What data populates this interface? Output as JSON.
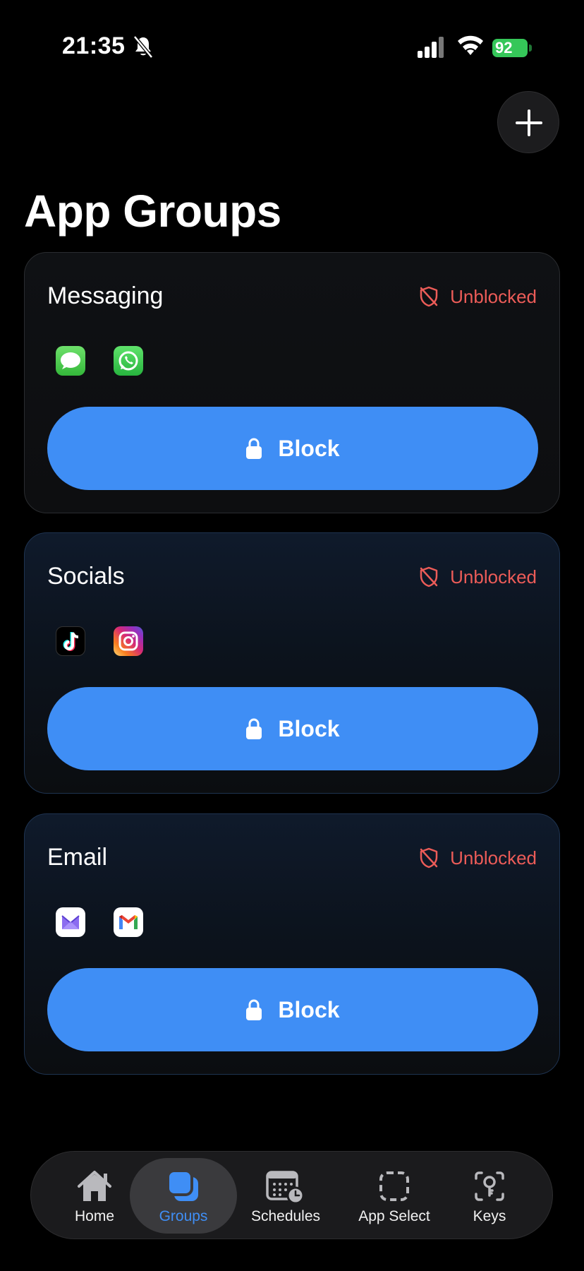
{
  "status_bar": {
    "time": "21:35",
    "battery": "92",
    "icons": [
      "bell-slash-icon",
      "signal-icon",
      "wifi-icon",
      "battery-icon"
    ]
  },
  "header": {
    "title": "App Groups",
    "add_icon": "plus-icon"
  },
  "groups": [
    {
      "name": "Messaging",
      "status": "Unblocked",
      "apps": [
        "messages-app-icon",
        "whatsapp-app-icon"
      ],
      "button_label": "Block"
    },
    {
      "name": "Socials",
      "status": "Unblocked",
      "apps": [
        "tiktok-app-icon",
        "instagram-app-icon"
      ],
      "button_label": "Block"
    },
    {
      "name": "Email",
      "status": "Unblocked",
      "apps": [
        "proton-mail-app-icon",
        "gmail-app-icon"
      ],
      "button_label": "Block"
    }
  ],
  "tab_bar": {
    "items": [
      {
        "label": "Home",
        "icon": "house-icon",
        "active": false
      },
      {
        "label": "Groups",
        "icon": "square-stack-icon",
        "active": true
      },
      {
        "label": "Schedules",
        "icon": "calendar-clock-icon",
        "active": false
      },
      {
        "label": "App Select",
        "icon": "dashed-square-icon",
        "active": false
      },
      {
        "label": "Keys",
        "icon": "key-icon",
        "active": false
      }
    ]
  },
  "colors": {
    "accent": "#3f8ef5",
    "unblocked": "#ec5c58",
    "battery": "#35c759",
    "background": "#000000"
  }
}
